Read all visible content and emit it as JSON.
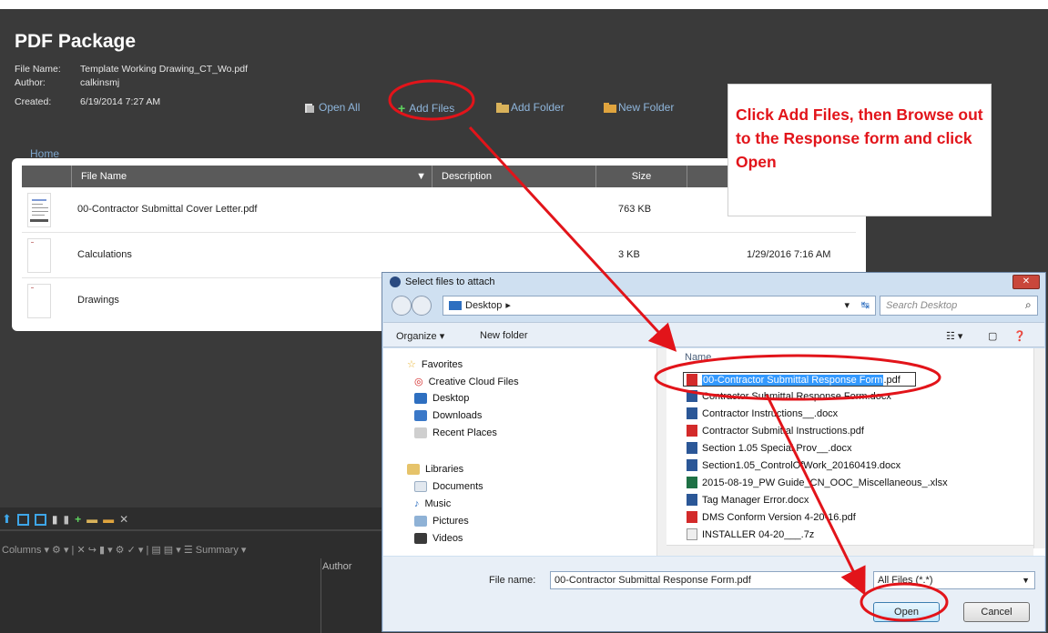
{
  "package": {
    "title": "PDF Package",
    "file_name_label": "File Name:",
    "file_name": "Template Working Drawing_CT_Wo.pdf",
    "author_label": "Author:",
    "author": "calkinsmj",
    "created_label": "Created:",
    "created": "6/19/2014 7:27 AM",
    "toolbar": {
      "open_all": "Open All",
      "add_files": "Add Files",
      "add_folder": "Add Folder",
      "new_folder": "New Folder"
    },
    "home": "Home",
    "columns": {
      "file_name": "File Name",
      "description": "Description",
      "size": "Size"
    },
    "rows": [
      {
        "name": "00-Contractor Submittal Cover Letter.pdf",
        "size": "763 KB",
        "date": ""
      },
      {
        "name": "Calculations",
        "size": "3 KB",
        "date": "1/29/2016 7:16 AM"
      },
      {
        "name": "Drawings",
        "size": "",
        "date": ""
      }
    ]
  },
  "annotation": {
    "text": "Click Add Files, then Browse out to the Response form and click Open"
  },
  "bottom_toolbar": {
    "row2": "Columns ▾  ⚙ ▾ | ✕  ↪  ▮ ▾  ⚙ ✓ ▾ | ▤ ▤ ▾  ☰ Summary ▾",
    "author_col": "Author"
  },
  "dialog": {
    "title": "Select files to attach",
    "close": "✕",
    "address": "Desktop",
    "search_placeholder": "Search Desktop",
    "organize": "Organize ▾",
    "new_folder": "New folder",
    "column_name": "Name",
    "nav": {
      "favorites": "Favorites",
      "creative_cloud": "Creative Cloud Files",
      "desktop": "Desktop",
      "downloads": "Downloads",
      "recent_places": "Recent Places",
      "libraries": "Libraries",
      "documents": "Documents",
      "music": "Music",
      "pictures": "Pictures",
      "videos": "Videos"
    },
    "files": {
      "selected_name": "00-Contractor Submittal Response Form",
      "selected_ext": ".pdf",
      "f1": "Contractor Submittal Response Form.docx",
      "f2": "Contractor Instructions__.docx",
      "f3": "Contractor Submittal Instructions.pdf",
      "f4": "Section 1.05 Special Prov__.docx",
      "f5": "Section1.05_ControlOfWork_20160419.docx",
      "f6": "2015-08-19_PW Guide_CN_OOC_Miscellaneous_.xlsx",
      "f7": "Tag Manager Error.docx",
      "f8": "DMS Conform Version 4-20-16.pdf",
      "f9": "INSTALLER 04-20___.7z"
    },
    "file_name_label": "File name:",
    "file_name_value": "00-Contractor Submittal Response Form.pdf",
    "filter": "All Files (*.*)",
    "open": "Open",
    "cancel": "Cancel"
  },
  "colors": {
    "panel": "#3a3a3a",
    "accent_link": "#8fb6dc",
    "annotation_red": "#e2141a",
    "selection": "#3399ff"
  }
}
